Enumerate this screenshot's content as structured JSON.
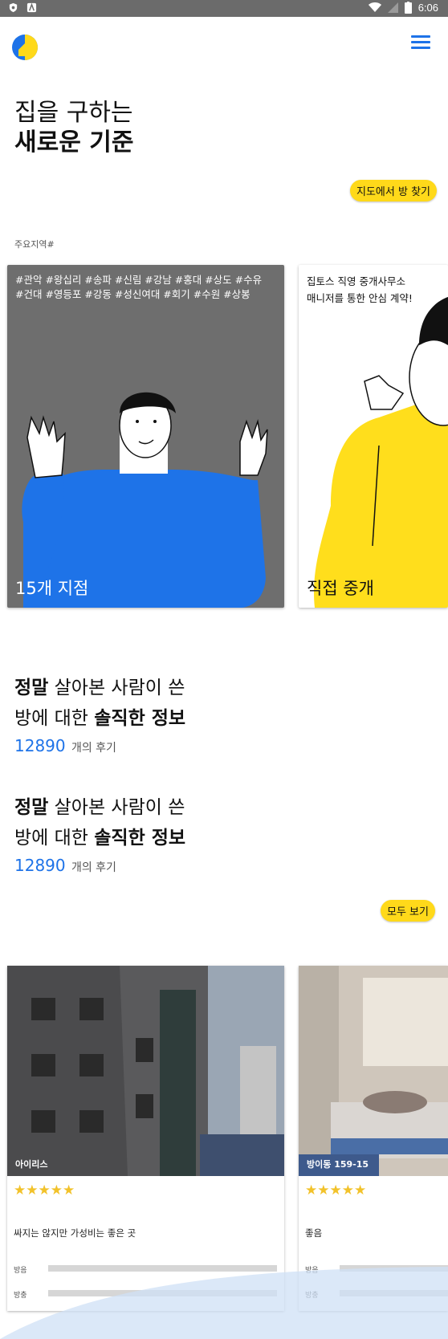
{
  "status_bar": {
    "time": "6:06"
  },
  "header": {
    "logo_icon": "app-logo-icon",
    "menu_icon": "hamburger-menu-icon",
    "accent": "#1e73e8"
  },
  "hero": {
    "line1": "집을 구하는",
    "line2": "새로운 기준"
  },
  "map_button": {
    "label": "지도에서 방 찾기"
  },
  "regions_label": "주요지역#",
  "branch_cards": [
    {
      "tags": "#관악 #왕십리 #송파 #신림 #강남 #홍대 #상도 #수유 #건대 #영등포 #강동 #성신여대 #회기 #수원 #상봉",
      "title": "15개 지점"
    },
    {
      "line1": "집토스 직영 중개사무소",
      "line2": "매니저를 통한 안심 계약!",
      "title": "직접 중개"
    }
  ],
  "info_blocks": [
    {
      "w1": "정말",
      "t1": " 살아본 사람이 쓴",
      "t2": "방에 대한 ",
      "w2": "솔직한 정보",
      "count": "12890",
      "count_label": "개의 후기"
    },
    {
      "w1": "정말",
      "t1": " 살아본 사람이 쓴",
      "t2": "방에 대한 ",
      "w2": "솔직한 정보",
      "count": "12890",
      "count_label": "개의 후기"
    }
  ],
  "see_all_button": {
    "label": "모두 보기"
  },
  "reviews": [
    {
      "place": "아이리스",
      "rating": 4.5,
      "stars": "★★★★★",
      "text": "싸지는 않지만 가성비는 좋은 곳",
      "bar1_label": "방음",
      "bar2_label": "방충"
    },
    {
      "place": "방이동 159-15",
      "rating": 5,
      "stars": "★★★★★",
      "text": "좋음",
      "bar1_label": "방음",
      "bar2_label": "방충"
    }
  ],
  "colors": {
    "yellow": "#ffd91a",
    "blue": "#1e73e8",
    "card_gray": "#6e6e6e"
  }
}
